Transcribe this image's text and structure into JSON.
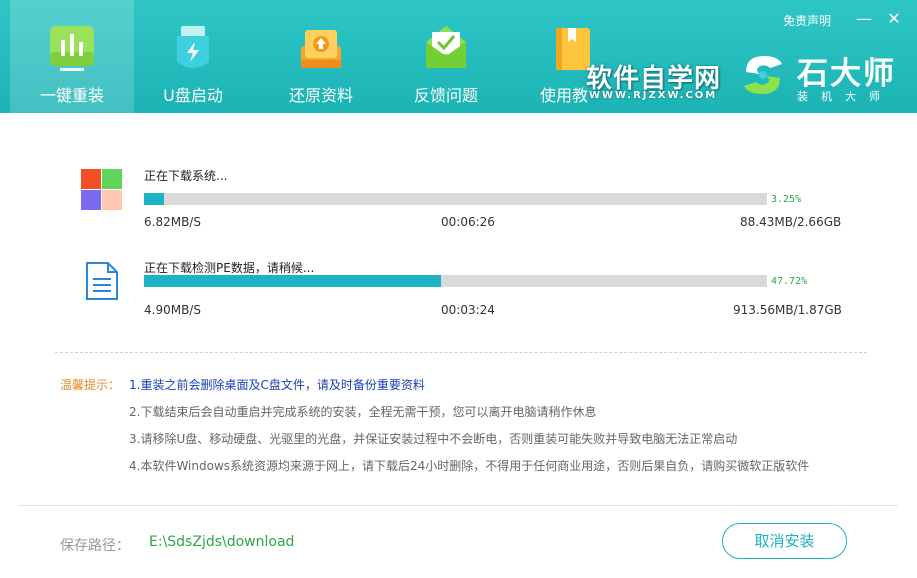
{
  "header": {
    "tabs": [
      {
        "label": "一键重装",
        "icon": "bar-chart-icon",
        "active": true
      },
      {
        "label": "U盘启动",
        "icon": "usb-drive-icon",
        "active": false
      },
      {
        "label": "还原资料",
        "icon": "restore-upload-icon",
        "active": false
      },
      {
        "label": "反馈问题",
        "icon": "mail-envelope-icon",
        "active": false
      },
      {
        "label": "使用教",
        "icon": "book-icon",
        "active": false
      }
    ],
    "disclaimer": "免责声明",
    "minimize": "—",
    "close": "✕",
    "watermark_text": "软件自学网",
    "watermark_url": "WWW.RJZXW.COM",
    "brand_name": "石大师",
    "brand_sub": "装机大师",
    "accent_color": "#1cb3b5"
  },
  "downloads": [
    {
      "title": "正在下载系统...",
      "icon": "windows-logo-icon",
      "progress": 3.25,
      "percent_text": "3.25%",
      "speed": "6.82MB/S",
      "time": "00:06:26",
      "size": "88.43MB/2.66GB"
    },
    {
      "title": "正在下载检测PE数据，请稍候...",
      "icon": "document-icon",
      "progress": 47.72,
      "percent_text": "47.72%",
      "speed": "4.90MB/S",
      "time": "00:03:24",
      "size": "913.56MB/1.87GB"
    }
  ],
  "tips": {
    "label": "温馨提示：",
    "items": [
      "1.重装之前会删除桌面及C盘文件，请及时备份重要资料",
      "2.下载结束后会自动重启并完成系统的安装，全程无需干预，您可以离开电脑请稍作休息",
      "3.请移除U盘、移动硬盘、光驱里的光盘，并保证安装过程中不会断电，否则重装可能失败并导致电脑无法正常启动",
      "4.本软件Windows系统资源均来源于网上，请下载后24小时删除，不得用于任何商业用途，否则后果自负，请购买微软正版软件"
    ]
  },
  "footer": {
    "path_label": "保存路径：",
    "path_value": "E:\\SdsZjds\\download",
    "cancel_label": "取消安装"
  }
}
